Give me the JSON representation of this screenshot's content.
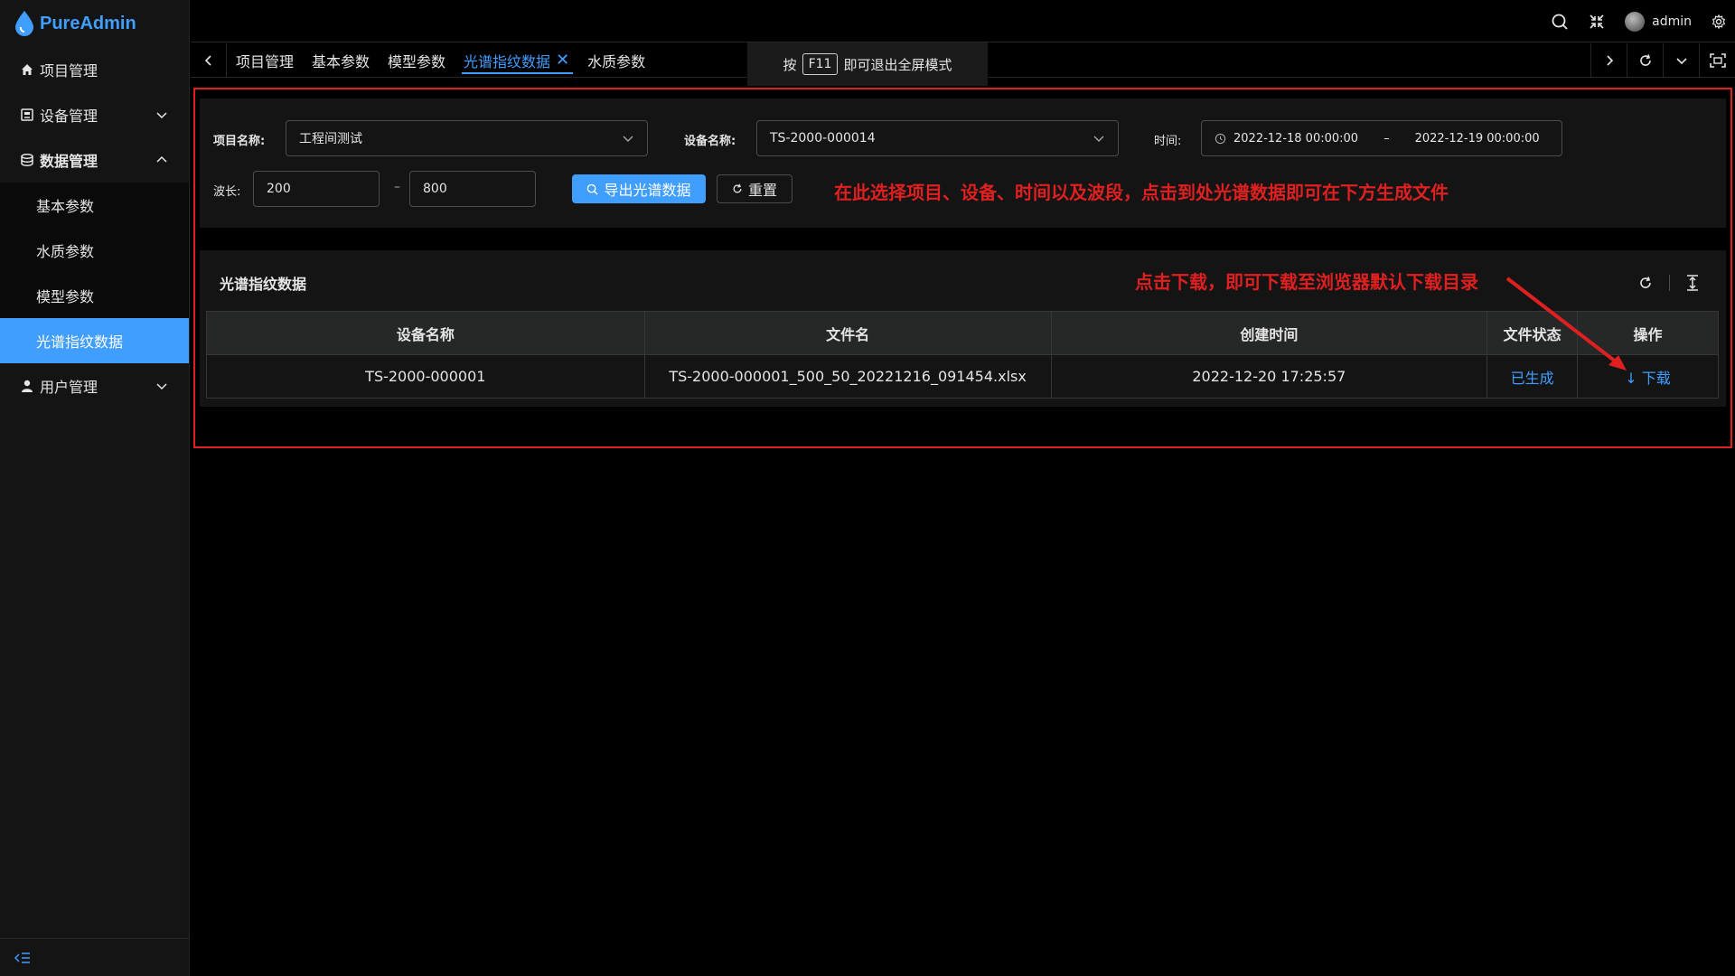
{
  "app": {
    "name": "PureAdmin",
    "brand_color": "#409eff",
    "annotation_color": "#e02020"
  },
  "sidebar": {
    "items": [
      {
        "label": "项目管理",
        "icon": "home-icon"
      },
      {
        "label": "设备管理",
        "icon": "device-icon"
      },
      {
        "label": "数据管理",
        "icon": "database-icon"
      },
      {
        "label": "用户管理",
        "icon": "user-icon"
      }
    ],
    "sub_items": [
      {
        "label": "基本参数"
      },
      {
        "label": "水质参数"
      },
      {
        "label": "模型参数"
      },
      {
        "label": "光谱指纹数据",
        "active": true
      }
    ]
  },
  "topbar": {
    "username": "admin"
  },
  "tabs": [
    {
      "label": "项目管理"
    },
    {
      "label": "基本参数"
    },
    {
      "label": "模型参数"
    },
    {
      "label": "光谱指纹数据",
      "active": true
    },
    {
      "label": "水质参数"
    }
  ],
  "fullscreen_tip": {
    "prefix": "按",
    "key": "F11",
    "suffix": "即可退出全屏模式"
  },
  "search": {
    "project_label": "项目名称:",
    "project_value": "工程间测试",
    "device_label": "设备名称:",
    "device_value": "TS-2000-000014",
    "time_label": "时间:",
    "time_start": "2022-12-18 00:00:00",
    "time_sep": "–",
    "time_end": "2022-12-19 00:00:00",
    "wave_label": "波长:",
    "wave_min": "200",
    "wave_sep": "–",
    "wave_max": "800",
    "export_button": "导出光谱数据",
    "reset_button": "重置"
  },
  "annotations": {
    "search_hint": "在此选择项目、设备、时间以及波段，点击到处光谱数据即可在下方生成文件",
    "download_hint": "点击下载，即可下载至浏览器默认下载目录"
  },
  "table": {
    "title": "光谱指纹数据",
    "columns": [
      "设备名称",
      "文件名",
      "创建时间",
      "文件状态",
      "操作"
    ],
    "rows": [
      {
        "device": "TS-2000-000001",
        "file": "TS-2000-000001_500_50_20221216_091454.xlsx",
        "created": "2022-12-20 17:25:57",
        "status": "已生成",
        "action": "下载"
      }
    ]
  }
}
